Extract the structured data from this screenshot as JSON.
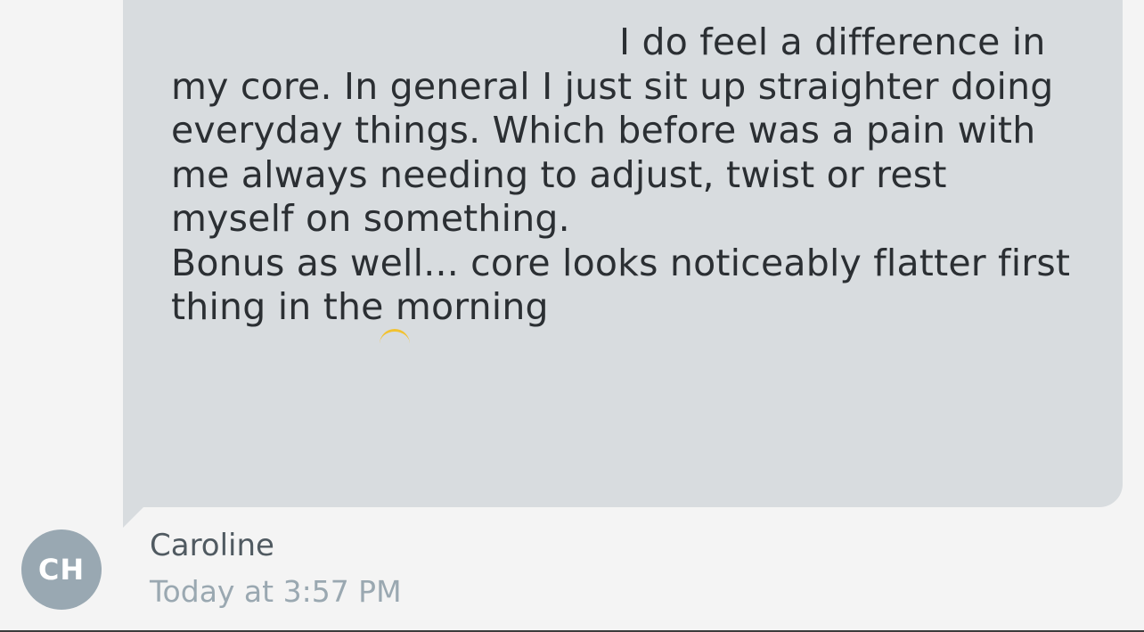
{
  "message": {
    "lines": [
      "I do feel a difference in",
      "my core. In general I just sit up straighter doing",
      "everyday things. Which before was a pain with",
      "me always needing to adjust, twist or rest",
      "myself on something.",
      "Bonus as well... core looks noticeably flatter first",
      "thing in the morning"
    ],
    "bubble_color": "#d8dcdf",
    "emoji_icon": "partial-emoji-icon"
  },
  "sender": {
    "initials": "CH",
    "name": "Caroline",
    "timestamp": "Today at 3:57 PM",
    "avatar_color": "#99a8b2"
  }
}
